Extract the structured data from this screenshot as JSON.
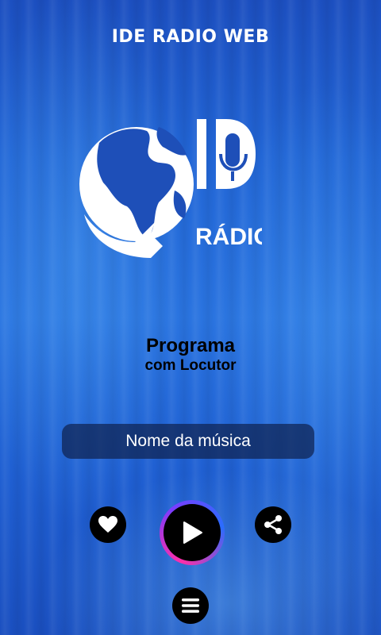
{
  "app": {
    "title": "IDE RADIO WEB"
  },
  "logo": {
    "text_main": "ID",
    "text_sub": "RÁDIO W",
    "icon": "globe-microphone-logo"
  },
  "program": {
    "line1": "Programa",
    "line2": "com Locutor"
  },
  "player": {
    "song_name": "Nome da música"
  },
  "controls": {
    "favorite_icon": "heart-icon",
    "play_icon": "play-icon",
    "share_icon": "share-icon",
    "menu_icon": "hamburger-menu-icon"
  },
  "colors": {
    "background": "#2266d6",
    "button": "#000000",
    "accent_ring": "#ff2ea8"
  }
}
